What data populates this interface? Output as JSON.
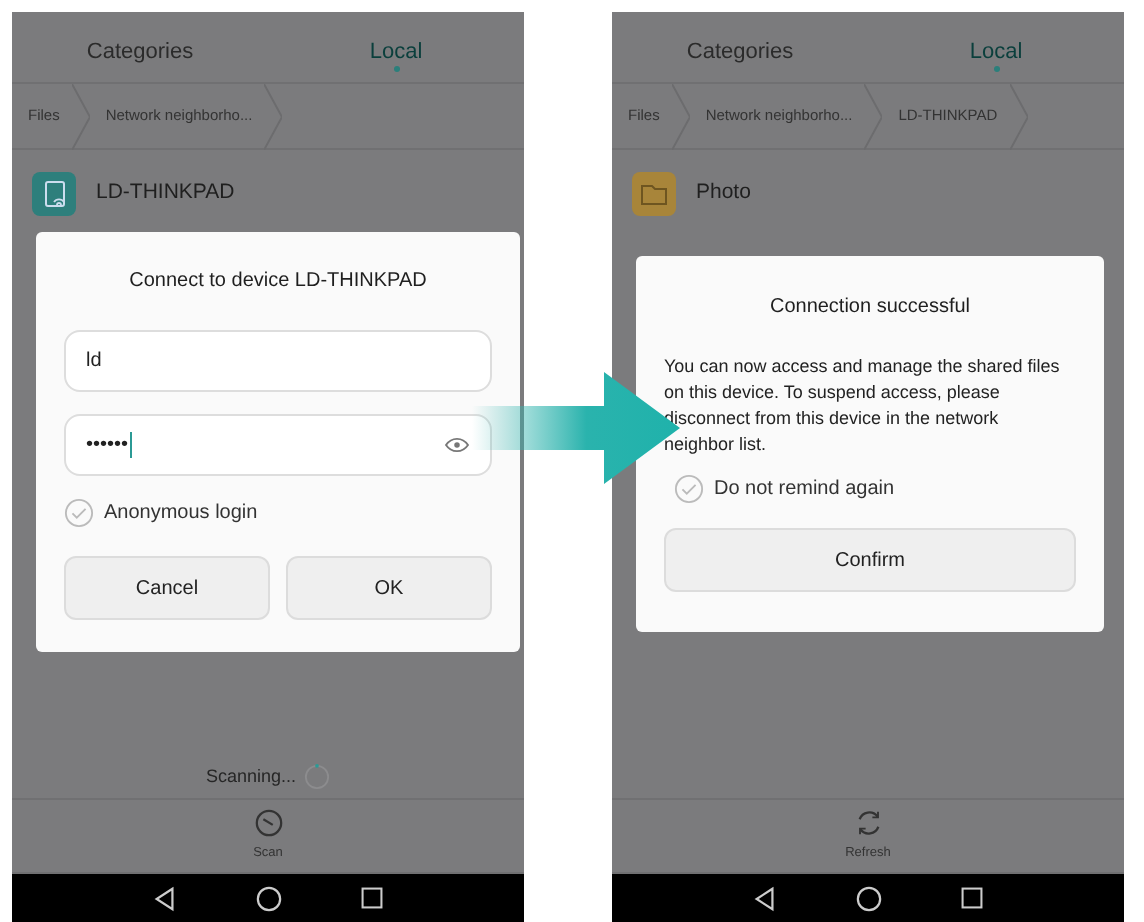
{
  "screens": [
    {
      "tabs": [
        {
          "label": "Categories",
          "selected": false
        },
        {
          "label": "Local",
          "selected": true
        }
      ],
      "breadcrumb": [
        "Files",
        "Network neighborho..."
      ],
      "items": [
        {
          "name": "LD-THINKPAD",
          "kind": "device"
        }
      ],
      "status": "Scanning...",
      "toolbar_action": {
        "label": "Scan",
        "kind": "scan"
      },
      "dialog": {
        "kind": "login",
        "title": "Connect to device LD-THINKPAD",
        "username": "ld",
        "password_mask": "••••••",
        "option": {
          "label": "Anonymous login",
          "checked": false
        },
        "buttons": [
          "Cancel",
          "OK"
        ]
      }
    },
    {
      "tabs": [
        {
          "label": "Categories",
          "selected": false
        },
        {
          "label": "Local",
          "selected": true
        }
      ],
      "breadcrumb": [
        "Files",
        "Network neighborho...",
        "LD-THINKPAD"
      ],
      "items": [
        {
          "name": "Photo",
          "kind": "folder"
        }
      ],
      "toolbar_action": {
        "label": "Refresh",
        "kind": "refresh"
      },
      "dialog": {
        "kind": "message",
        "title": "Connection successful",
        "message": "You can now access and manage the shared files on this device. To suspend access, please disconnect from this device in the network neighbor list.",
        "option": {
          "label": "Do not remind again",
          "checked": false
        },
        "buttons": [
          "Confirm"
        ]
      }
    }
  ]
}
